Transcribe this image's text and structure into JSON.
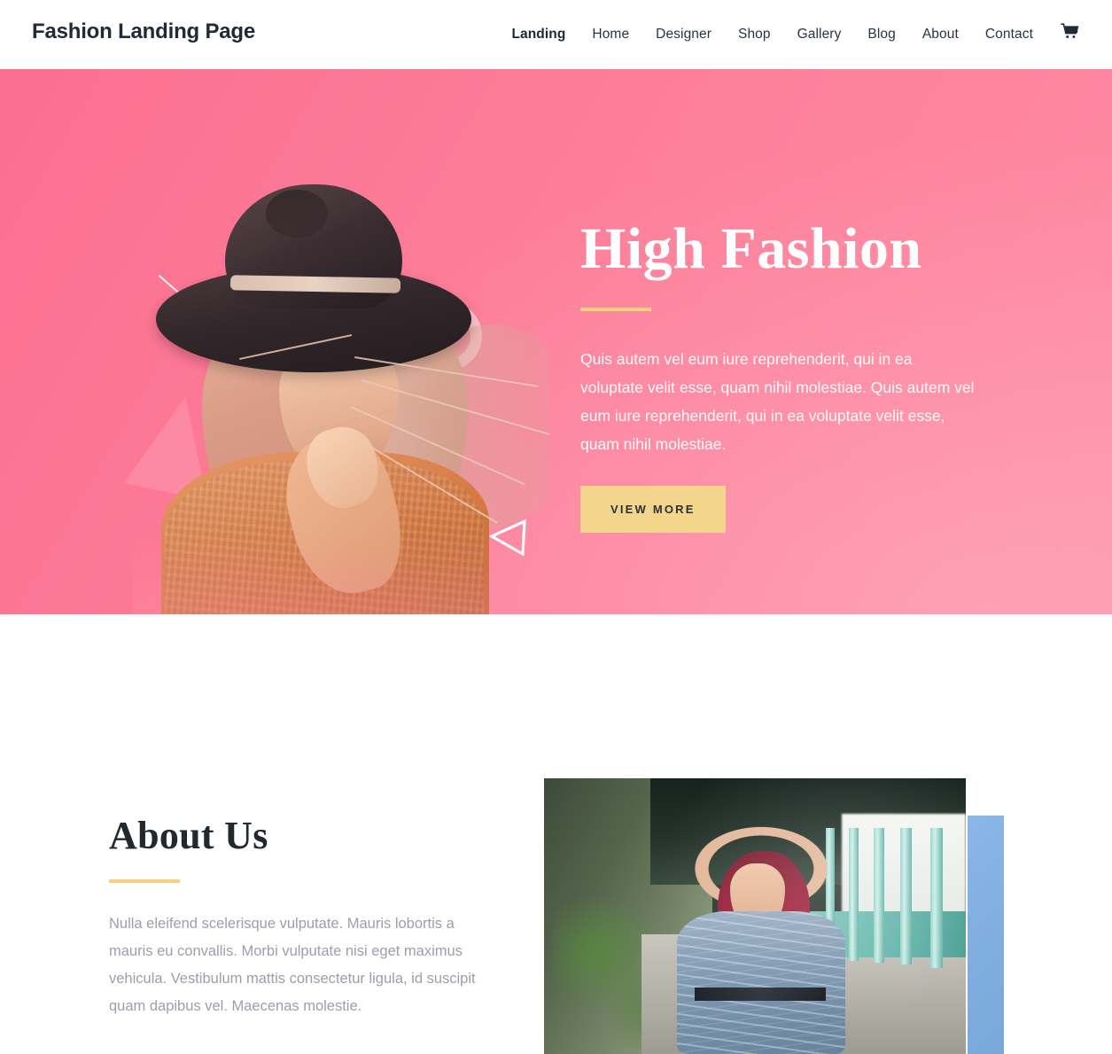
{
  "header": {
    "brand": "Fashion Landing Page",
    "nav": [
      {
        "label": "Landing",
        "active": true
      },
      {
        "label": "Home",
        "active": false
      },
      {
        "label": "Designer",
        "active": false
      },
      {
        "label": "Shop",
        "active": false
      },
      {
        "label": "Gallery",
        "active": false
      },
      {
        "label": "Blog",
        "active": false
      },
      {
        "label": "About",
        "active": false
      },
      {
        "label": "Contact",
        "active": false
      }
    ],
    "cart_icon": "shopping-cart-icon"
  },
  "hero": {
    "title": "High Fashion",
    "paragraph": "Quis autem vel eum iure reprehenderit, qui in ea voluptate velit esse, quam nihil molestiae. Quis autem vel eum iure reprehenderit, qui in ea voluptate velit esse, quam nihil molestiae.",
    "button_label": "VIEW MORE",
    "background_color": "#fd7e99",
    "accent_color": "#f5d27c",
    "button_color": "#f3d68b",
    "image_alt": "woman-in-wide-brim-hat-and-knit-sweater",
    "decorations": [
      "diagonal-line",
      "ring-outline",
      "triangle-outline",
      "large-translucent-triangle"
    ]
  },
  "about": {
    "title": "About Us",
    "paragraph": "Nulla eleifend scelerisque vulputate. Mauris lobortis a mauris eu convallis. Morbi vulputate nisi eget maximus vehicula. Vestibulum mattis consectetur ligula, id suscipit quam dapibus vel. Maecenas molestie.",
    "accent_color": "#f5d181",
    "text_color": "#9aa0ab",
    "image_alt": "woman-with-red-hair-in-blue-dress-in-colonnade",
    "accent_block_color": "#82b3e8"
  }
}
